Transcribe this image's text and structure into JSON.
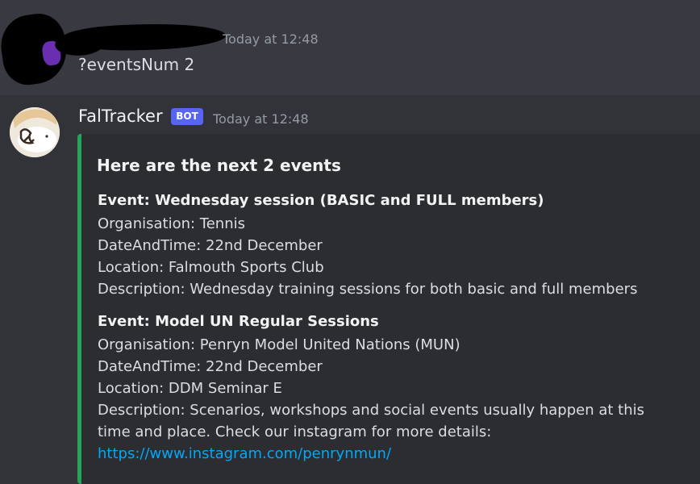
{
  "user_message": {
    "timestamp": "Today at 12:48",
    "content": "?eventsNum 2"
  },
  "bot_message": {
    "name": "FalTracker",
    "badge": "BOT",
    "timestamp": "Today at 12:48",
    "embed": {
      "accent_color": "#23a55a",
      "title": "Here are the next 2 events",
      "events": [
        {
          "heading": "Event: Wednesday session (BASIC and FULL members)",
          "organisation": "Organisation: Tennis",
          "datetime": "DateAndTime: 22nd December",
          "location": "Location: Falmouth Sports Club",
          "description": "Description: Wednesday training sessions for both basic and full members"
        },
        {
          "heading": "Event: Model UN Regular Sessions",
          "organisation": "Organisation: Penryn Model United Nations (MUN)",
          "datetime": "DateAndTime: 22nd December",
          "location": "Location: DDM Seminar E",
          "description": "Description: Scenarios, workshops and social events usually happen at this time and place. Check our instagram for more details:",
          "link": "https://www.instagram.com/penrynmun/"
        }
      ]
    }
  },
  "colors": {
    "background": "#323339",
    "hovered_message": "#393a41",
    "embed_background": "#2b2d31",
    "badge": "#5865f2",
    "link": "#00a8fc"
  }
}
